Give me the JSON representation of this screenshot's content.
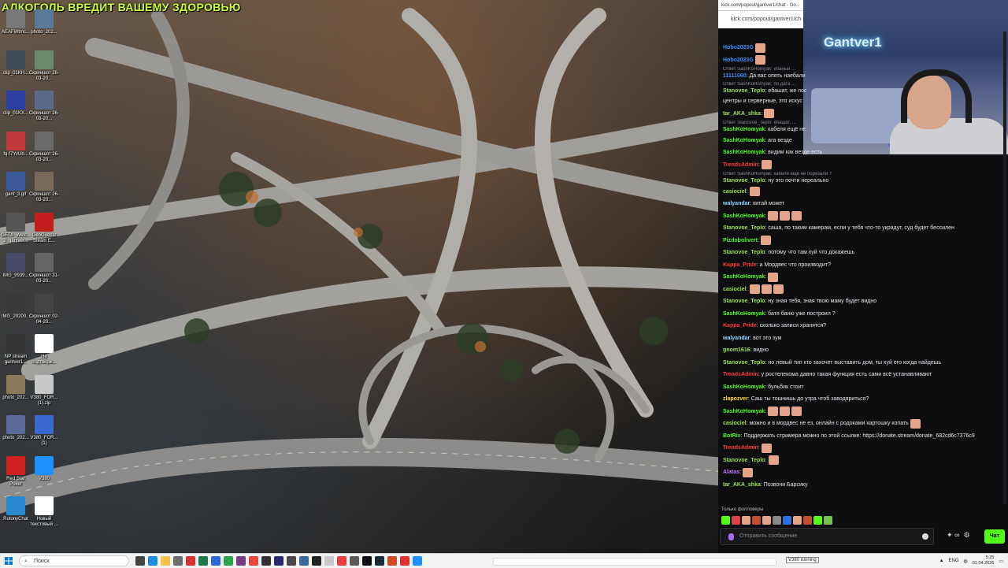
{
  "overlay_title": "АЛКОГОЛЬ ВРЕДИТ ВАШЕМУ ЗДОРОВЬЮ",
  "desktop_icons": [
    {
      "label": "AEAFWtmc...",
      "color": "#777"
    },
    {
      "label": "photo_202...",
      "color": "#5a7a9a"
    },
    {
      "label": "clip_01KH...",
      "color": "#3e4a5a"
    },
    {
      "label": "Скриншот 26-03-20...",
      "color": "#6a8a6a"
    },
    {
      "label": "clip_01KX...",
      "color": "#2c3ea0"
    },
    {
      "label": "Скриншот 26-03-20...",
      "color": "#5a6a8a"
    },
    {
      "label": "fq-f7YvUb...",
      "color": "#c23a3a"
    },
    {
      "label": "Скриншот 26-03-20...",
      "color": "#6a6a6a"
    },
    {
      "label": "gant_3.gif",
      "color": "#3a5a9a"
    },
    {
      "label": "Скриншот 26-03-20...",
      "color": "#7a6a5a"
    },
    {
      "label": "GETA_Welc... 2_gantver...",
      "color": "#555"
    },
    {
      "label": "GeoGuessr Steam E...",
      "color": "#c21e1e"
    },
    {
      "label": "IMG_9939...",
      "color": "#4a4a6a"
    },
    {
      "label": "Скриншот 31-03-20...",
      "color": "#666"
    },
    {
      "label": "IMG_20200...",
      "color": "#3a3a3a"
    },
    {
      "label": "Скриншот 02-04-20...",
      "color": "#444"
    },
    {
      "label": "NP stream gantver1...",
      "color": "#333"
    },
    {
      "label": "Не подтверж...",
      "color": "#fff"
    },
    {
      "label": "photo_202...",
      "color": "#8a7a5a"
    },
    {
      "label": "V380_FOR... (1).zip",
      "color": "#c8c8c8"
    },
    {
      "label": "photo_202...",
      "color": "#5a6a9a"
    },
    {
      "label": "V380_FOR... (1)",
      "color": "#3a6ad0"
    },
    {
      "label": "Red Star Poker",
      "color": "#d02020"
    },
    {
      "label": "V380",
      "color": "#1e90ff"
    },
    {
      "label": "RutonyChat",
      "color": "#2a8ad0"
    },
    {
      "label": "Новый текстовый ...",
      "color": "#fff"
    }
  ],
  "browser": {
    "tab_title": "kick.com/popout/gantver1/chat - Go...",
    "url": "kick.com/popout/gantver1/ch"
  },
  "webcam": {
    "neon_sign": "Gantver1"
  },
  "chat": {
    "messages": [
      {
        "reply": "",
        "user": "Hobo2023G",
        "text": "",
        "color": "#3e8bf6",
        "emotes": 1
      },
      {
        "reply": "",
        "user": "Hobo2023G",
        "text": "",
        "color": "#3e8bf6",
        "emotes": 1
      },
      {
        "reply": "Ответ SashKoHomyak: ебаный ...",
        "user": "11111060",
        "text": ": Да вас опять наебали",
        "color": "#3e8bf6",
        "emotes": 0
      },
      {
        "reply": "Ответ SashKoHomyak: по дата ...",
        "user": "Stanovoe_Teplo",
        "text": ": ебашат, же пос",
        "color": "#9ee05a",
        "emotes": 0
      },
      {
        "reply": "",
        "user": "",
        "text": "центры и серверные, это искус",
        "color": "#9ee05a",
        "emotes": 0
      },
      {
        "reply": "",
        "user": "tar_AKA_shka",
        "text": ":",
        "color": "#9ee05a",
        "emotes": 1
      },
      {
        "reply": "Ответ Stanovoe_Teplo: ебашат, ...",
        "user": "SashKoHomyak",
        "text": ": кабеля ещё не",
        "color": "#53fc18",
        "emotes": 0
      },
      {
        "reply": "",
        "user": "SashKoHomyak",
        "text": ": ага везде",
        "color": "#53fc18",
        "emotes": 0
      },
      {
        "reply": "",
        "user": "SashKoHomyak",
        "text": ": видим как везде есть",
        "color": "#53fc18",
        "emotes": 0
      },
      {
        "reply": "",
        "user": "TrendsAdmin",
        "text": ":",
        "color": "#ff3b3b",
        "emotes": 1
      },
      {
        "reply": "Ответ SashKoHomyak: кабеля ещё не порезали ?",
        "user": "Stanovoe_Teplo",
        "text": ": ну это почти нереально",
        "color": "#9ee05a",
        "emotes": 0
      },
      {
        "reply": "",
        "user": "casiociel",
        "text": ":",
        "color": "#9ee05a",
        "emotes": 1
      },
      {
        "reply": "",
        "user": "walyandar",
        "text": ": китай может",
        "color": "#8ad8ff",
        "emotes": 0
      },
      {
        "reply": "",
        "user": "SashKoHomyak",
        "text": ":",
        "color": "#53fc18",
        "emotes": 3
      },
      {
        "reply": "",
        "user": "Stanovoe_Teplo",
        "text": ": саша, по таким камерам, если у тебя что-то украдут, суд будет бессилен",
        "color": "#9ee05a",
        "emotes": 0
      },
      {
        "reply": "",
        "user": "Pizdobolivert",
        "text": ":",
        "color": "#53fc18",
        "emotes": 1
      },
      {
        "reply": "",
        "user": "Stanovoe_Teplo",
        "text": ": потому что там хуй что докажешь",
        "color": "#9ee05a",
        "emotes": 0
      },
      {
        "reply": "",
        "user": "Kappa_Pride",
        "text": ": а Мордвес что производит?",
        "color": "#ff3b3b",
        "emotes": 0
      },
      {
        "reply": "",
        "user": "SashKoHomyak",
        "text": ":",
        "color": "#53fc18",
        "emotes": 1
      },
      {
        "reply": "",
        "user": "casiociel",
        "text": ":",
        "color": "#9ee05a",
        "emotes": 3
      },
      {
        "reply": "",
        "user": "Stanovoe_Teplo",
        "text": ": ну зная тебя, зная твою маму будет видно",
        "color": "#9ee05a",
        "emotes": 0
      },
      {
        "reply": "",
        "user": "SashKoHomyak",
        "text": ": батя баню уже построил ?",
        "color": "#53fc18",
        "emotes": 0
      },
      {
        "reply": "",
        "user": "Kappa_Pride",
        "text": ": сколько записи хранятся?",
        "color": "#ff3b3b",
        "emotes": 0
      },
      {
        "reply": "",
        "user": "walyandar",
        "text": ": вот это зум",
        "color": "#8ad8ff",
        "emotes": 0
      },
      {
        "reply": "",
        "user": "gnom1616",
        "text": ": видно",
        "color": "#9ee05a",
        "emotes": 0
      },
      {
        "reply": "",
        "user": "Stanovoe_Teplo",
        "text": ": но левый тип кто захочет выставить дом, ты хуй его когда найдешь",
        "color": "#9ee05a",
        "emotes": 0
      },
      {
        "reply": "",
        "user": "TrendsAdmin",
        "text": ": у ростелекома давно такая функция есть сами всё устанавливают",
        "color": "#ff3b3b",
        "emotes": 0
      },
      {
        "reply": "",
        "user": "SashKoHomyak",
        "text": ": бульбик стоит",
        "color": "#53fc18",
        "emotes": 0
      },
      {
        "reply": "",
        "user": "zlapozver",
        "text": ": Саш ты тошнишь до утра чтоб заводяриться?",
        "color": "#ffd83b",
        "emotes": 0
      },
      {
        "reply": "",
        "user": "SashKoHomyak",
        "text": ":",
        "color": "#53fc18",
        "emotes": 3
      },
      {
        "reply": "",
        "user": "casiociel",
        "text": ": можно и в мордвес не ез, онлайн с родоками картошку копать",
        "color": "#9ee05a",
        "emotes": 1
      },
      {
        "reply": "",
        "user": "BotRix",
        "text": ": Поддержать стримера можно по этой ссылке: https://donate.stream/donate_682cd6c7376c9",
        "color": "#53fc18",
        "emotes": 0
      },
      {
        "reply": "",
        "user": "TrendsAdmin",
        "text": ":",
        "color": "#ff3b3b",
        "emotes": 1
      },
      {
        "reply": "",
        "user": "Stanovoe_Teplo",
        "text": ":",
        "color": "#9ee05a",
        "emotes": 1
      },
      {
        "reply": "",
        "user": "Alatas",
        "text": ":",
        "color": "#c27cff",
        "emotes": 1
      },
      {
        "reply": "",
        "user": "tar_AKA_shka",
        "text": ": Позвони Барсику",
        "color": "#9ee05a",
        "emotes": 0
      }
    ],
    "followers_only": "Только фолловеры",
    "input_placeholder": "Отправить сообщение",
    "send_label": "Чат"
  },
  "taskbar": {
    "search_placeholder": "Поиск",
    "running_label": "V380 running",
    "lang": "ENG",
    "time": "5:25",
    "date": "01.04.2026"
  }
}
